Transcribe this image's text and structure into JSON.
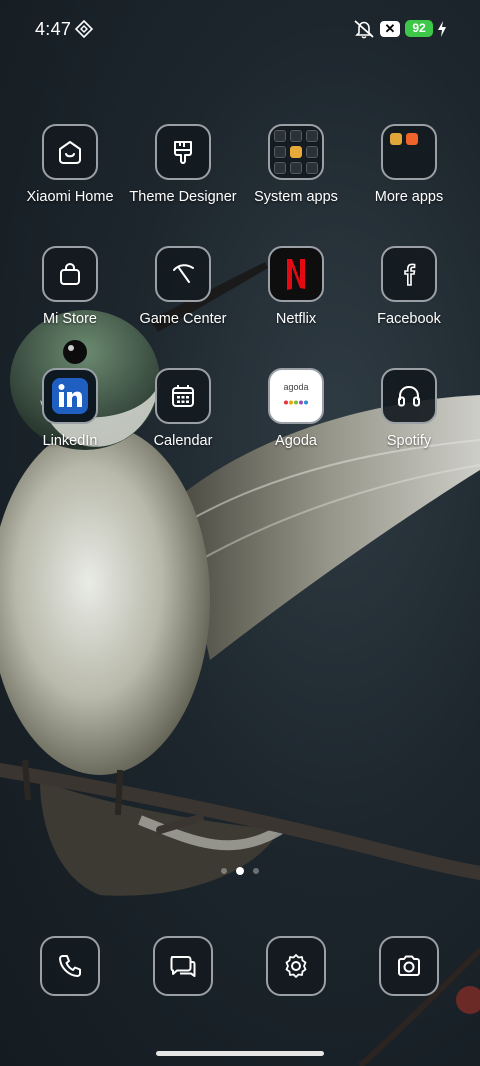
{
  "status_bar": {
    "time": "4:47",
    "battery_level": "92",
    "battery_color": "#3ec84a",
    "notification_badge": "✕",
    "icons": [
      "diamond-icon",
      "mute-icon",
      "x-badge-icon",
      "battery-icon",
      "charging-bolt-icon"
    ]
  },
  "apps": [
    {
      "label": "Xiaomi Home",
      "icon": "xiaomi-home-icon"
    },
    {
      "label": "Theme Designer",
      "icon": "brush-icon"
    },
    {
      "label": "System apps",
      "icon": "folder-icon"
    },
    {
      "label": "More apps",
      "icon": "folder-icon"
    },
    {
      "label": "Mi Store",
      "icon": "shopping-bag-icon"
    },
    {
      "label": "Game Center",
      "icon": "game-center-icon"
    },
    {
      "label": "Netflix",
      "icon": "netflix-icon",
      "brand_color": "#e50914"
    },
    {
      "label": "Facebook",
      "icon": "facebook-icon"
    },
    {
      "label": "LinkedIn",
      "icon": "linkedin-icon",
      "brand_color": "#1f5fc2"
    },
    {
      "label": "Calendar",
      "icon": "calendar-icon"
    },
    {
      "label": "Agoda",
      "icon": "agoda-icon",
      "logo_text": "agoda"
    },
    {
      "label": "Spotify",
      "icon": "headphones-icon"
    }
  ],
  "page_indicator": {
    "pages": 3,
    "current": 2
  },
  "dock": [
    {
      "icon": "phone-icon"
    },
    {
      "icon": "messages-icon"
    },
    {
      "icon": "settings-icon"
    },
    {
      "icon": "camera-icon"
    }
  ]
}
